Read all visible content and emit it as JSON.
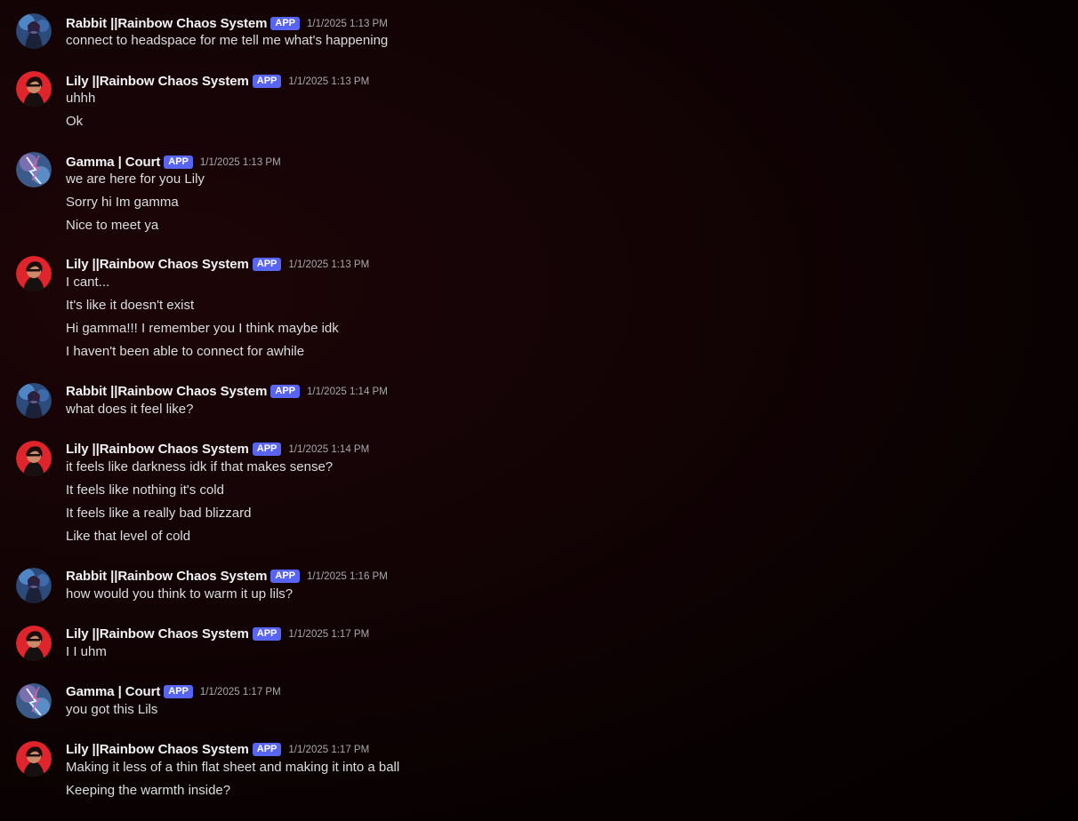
{
  "app_tag": "APP",
  "colors": {
    "app_tag_bg": "#5865f2",
    "background": "#120305",
    "author_text": "#f2f3f5",
    "message_text": "#dbdee1",
    "timestamp_text": "#a7a9ae"
  },
  "messages": [
    {
      "author": "Rabbit ||Rainbow Chaos System",
      "avatar": "rabbit-avatar",
      "timestamp": "1/1/2025 1:13 PM",
      "lines": [
        "connect to headspace for me tell me what's happening"
      ]
    },
    {
      "author": "Lily ||Rainbow Chaos System",
      "avatar": "lily-avatar",
      "timestamp": "1/1/2025 1:13 PM",
      "lines": [
        "uhhh",
        "Ok"
      ]
    },
    {
      "author": "Gamma | Court",
      "avatar": "gamma-avatar",
      "timestamp": "1/1/2025 1:13 PM",
      "lines": [
        "we are here for you Lily",
        "Sorry hi Im gamma",
        "Nice to meet ya"
      ]
    },
    {
      "author": "Lily ||Rainbow Chaos System",
      "avatar": "lily-avatar",
      "timestamp": "1/1/2025 1:13 PM",
      "lines": [
        "I cant...",
        "It's like it doesn't exist",
        "Hi gamma!!! I remember you I think maybe idk",
        "I haven't been able to connect for awhile"
      ]
    },
    {
      "author": "Rabbit ||Rainbow Chaos System",
      "avatar": "rabbit-avatar",
      "timestamp": "1/1/2025 1:14 PM",
      "lines": [
        "what does it feel like?"
      ]
    },
    {
      "author": "Lily ||Rainbow Chaos System",
      "avatar": "lily-avatar",
      "timestamp": "1/1/2025 1:14 PM",
      "lines": [
        "it feels like darkness idk if that makes sense?",
        "It feels like nothing it's cold",
        "It feels like a really bad blizzard",
        "Like that level of cold"
      ]
    },
    {
      "author": "Rabbit ||Rainbow Chaos System",
      "avatar": "rabbit-avatar",
      "timestamp": "1/1/2025 1:16 PM",
      "lines": [
        "how would you think to warm it up lils?"
      ]
    },
    {
      "author": "Lily ||Rainbow Chaos System",
      "avatar": "lily-avatar",
      "timestamp": "1/1/2025 1:17 PM",
      "lines": [
        "I I uhm"
      ]
    },
    {
      "author": "Gamma | Court",
      "avatar": "gamma-avatar",
      "timestamp": "1/1/2025 1:17 PM",
      "lines": [
        "you got this Lils"
      ]
    },
    {
      "author": "Lily ||Rainbow Chaos System",
      "avatar": "lily-avatar",
      "timestamp": "1/1/2025 1:17 PM",
      "lines": [
        "Making it less of a thin flat sheet and making it into a ball",
        "Keeping the warmth inside?"
      ]
    }
  ]
}
